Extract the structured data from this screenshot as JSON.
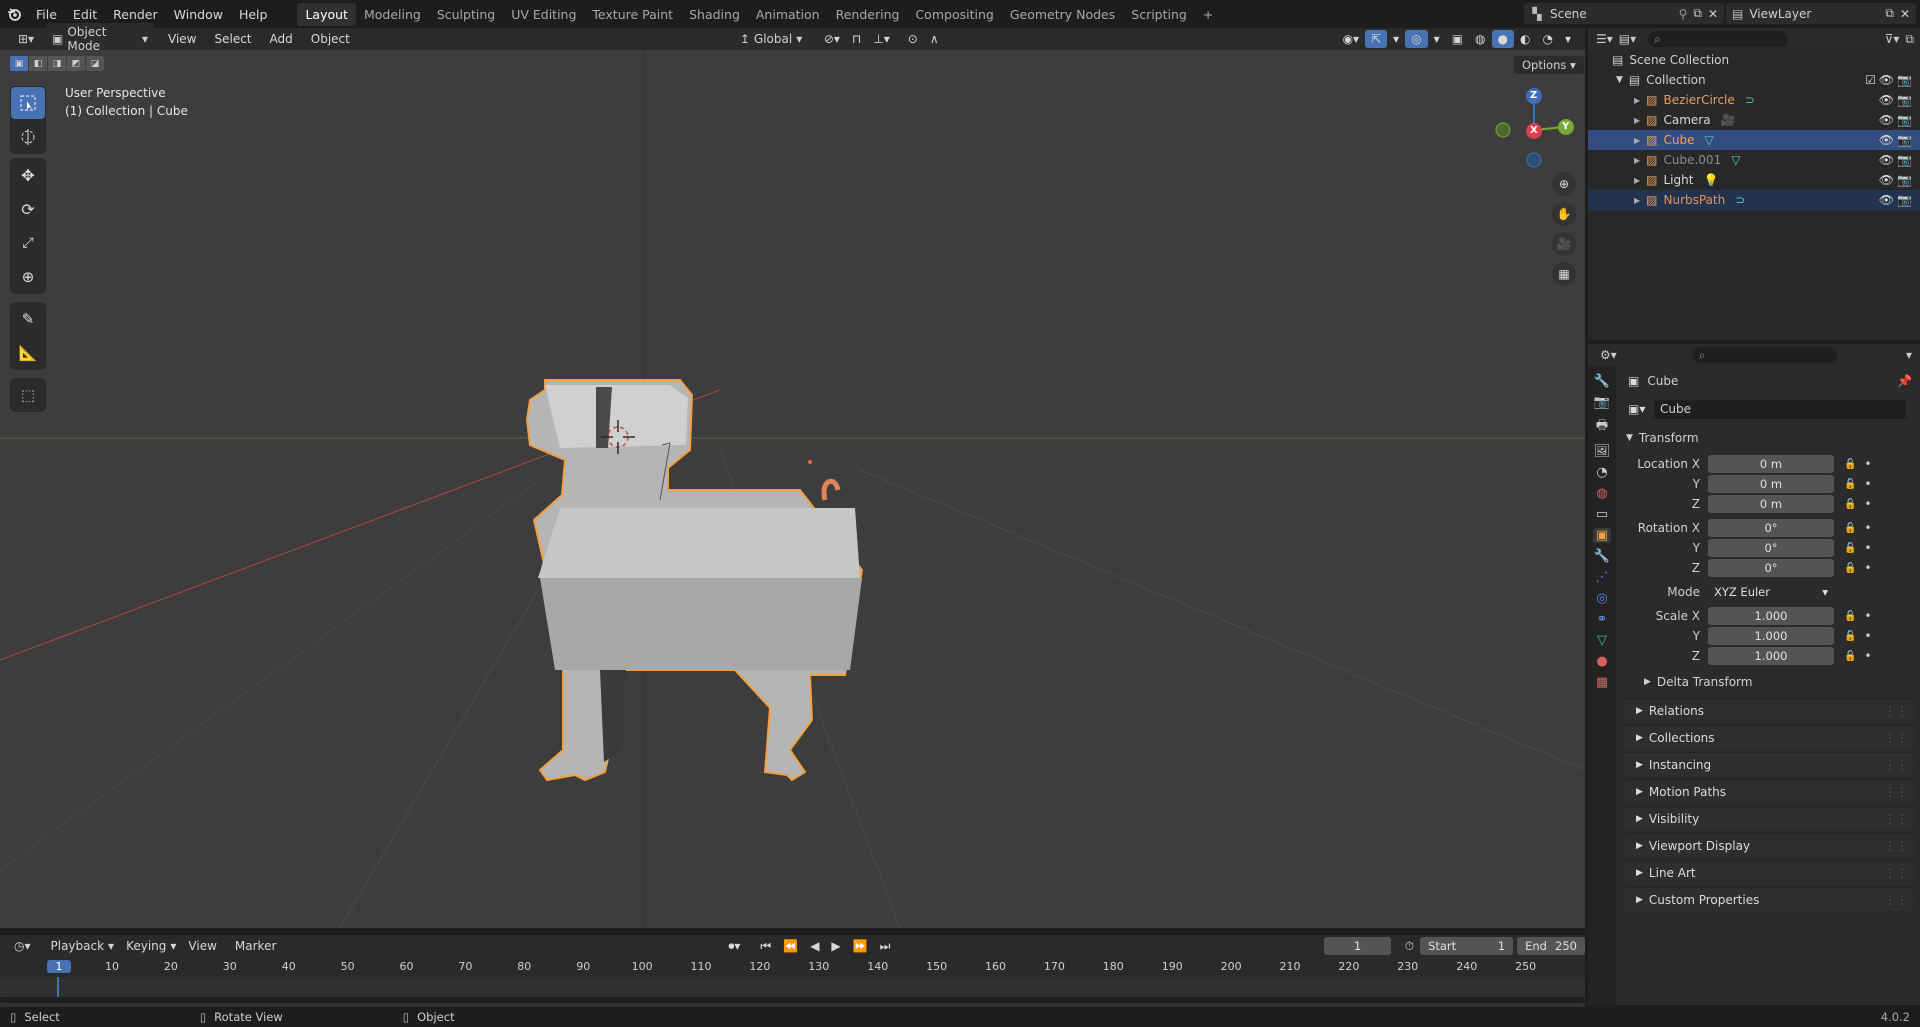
{
  "topbar": {
    "menus": [
      "File",
      "Edit",
      "Render",
      "Window",
      "Help"
    ],
    "workspaces": [
      "Layout",
      "Modeling",
      "Sculpting",
      "UV Editing",
      "Texture Paint",
      "Shading",
      "Animation",
      "Rendering",
      "Compositing",
      "Geometry Nodes",
      "Scripting"
    ],
    "active_workspace": "Layout",
    "scene": "Scene",
    "view_layer": "ViewLayer"
  },
  "viewport_header": {
    "mode": "Object Mode",
    "menus": [
      "View",
      "Select",
      "Add",
      "Object"
    ],
    "transform_orientation": "Global",
    "options": "Options"
  },
  "viewport": {
    "perspective": "User Perspective",
    "collection_info": "(1) Collection | Cube",
    "gizmo": {
      "z": "Z",
      "y": "Y",
      "x": "X"
    }
  },
  "outliner": {
    "scene_collection": "Scene Collection",
    "collection": "Collection",
    "items": [
      {
        "name": "BezierCircle",
        "color": "#e8a060"
      },
      {
        "name": "Camera",
        "color": "#d8d8d8"
      },
      {
        "name": "Cube",
        "color": "#f0a060",
        "selected": true
      },
      {
        "name": "Cube.001",
        "color": "#8a8a8a"
      },
      {
        "name": "Light",
        "color": "#d8d8d8"
      },
      {
        "name": "NurbsPath",
        "color": "#e89050",
        "highlight": true
      }
    ]
  },
  "properties": {
    "object_name": "Cube",
    "data_name": "Cube",
    "transform_label": "Transform",
    "location_label": "Location X",
    "rotation_label": "Rotation X",
    "scale_label": "Scale X",
    "y_label": "Y",
    "z_label": "Z",
    "mode_label": "Mode",
    "location": [
      "0 m",
      "0 m",
      "0 m"
    ],
    "rotation": [
      "0°",
      "0°",
      "0°"
    ],
    "rotation_mode": "XYZ Euler",
    "scale": [
      "1.000",
      "1.000",
      "1.000"
    ],
    "delta_transform": "Delta Transform",
    "panels": [
      "Relations",
      "Collections",
      "Instancing",
      "Motion Paths",
      "Visibility",
      "Viewport Display",
      "Line Art",
      "Custom Properties"
    ]
  },
  "timeline": {
    "menus": [
      "Playback",
      "Keying",
      "View",
      "Marker"
    ],
    "current_frame": "1",
    "start_label": "Start",
    "start": "1",
    "end_label": "End",
    "end": "250",
    "ruler": [
      "1",
      "10",
      "20",
      "30",
      "40",
      "50",
      "60",
      "70",
      "80",
      "90",
      "100",
      "110",
      "120",
      "130",
      "140",
      "150",
      "160",
      "170",
      "180",
      "190",
      "200",
      "210",
      "220",
      "230",
      "240",
      "250"
    ]
  },
  "statusbar": {
    "select": "Select",
    "rotate": "Rotate View",
    "object": "Object",
    "version": "4.0.2"
  },
  "colors": {
    "accent": "#4772b3",
    "selection": "#f0a040",
    "viewport": "#3d3d3d"
  }
}
